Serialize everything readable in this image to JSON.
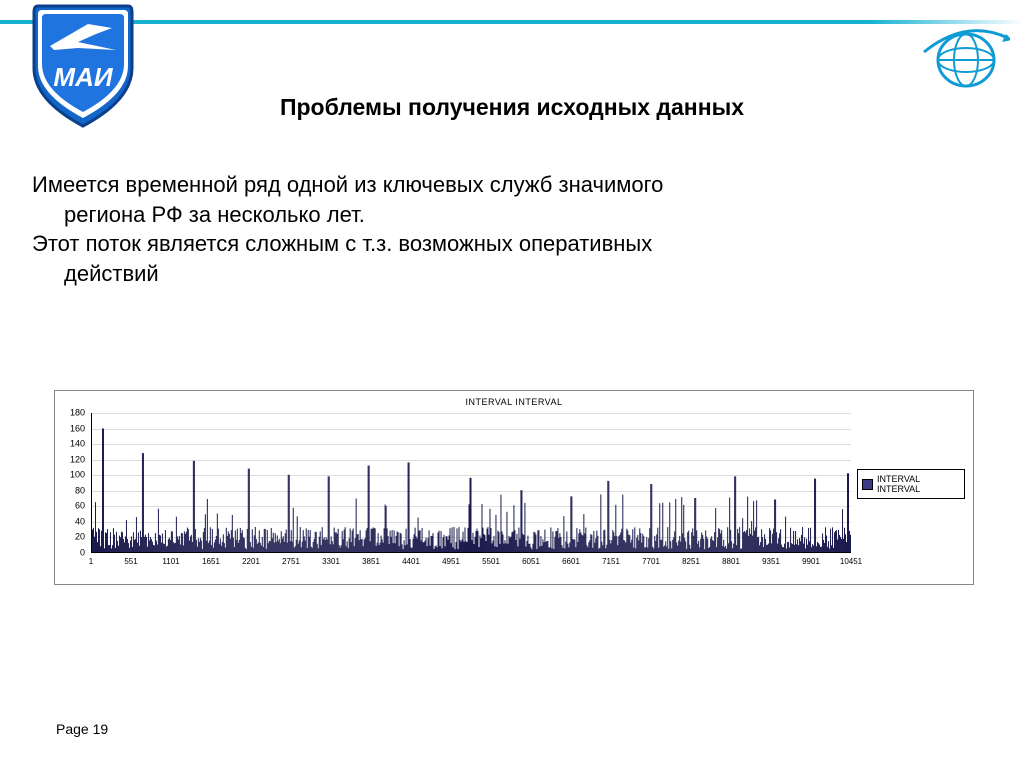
{
  "header": {
    "title": "Проблемы получения исходных данных",
    "logo_left_text": "МАИ"
  },
  "body": {
    "p1_line1": "Имеется временной ряд одной из ключевых служб значимого",
    "p1_line2": "региона РФ  за несколько лет.",
    "p2_line1": "Этот поток является сложным с т.з. возможных оперативных",
    "p2_line2": "действий"
  },
  "footer": {
    "page_label": "Page 19"
  },
  "chart_data": {
    "type": "bar",
    "title": "INTERVAL INTERVAL",
    "legend": "INTERVAL INTERVAL",
    "xlabel": "",
    "ylabel": "",
    "ylim": [
      0,
      180
    ],
    "xlim": [
      1,
      10451
    ],
    "yticks": [
      0,
      20,
      40,
      60,
      80,
      100,
      120,
      140,
      160,
      180
    ],
    "xticks": [
      1,
      551,
      1101,
      1651,
      2201,
      2751,
      3301,
      3851,
      4401,
      4951,
      5501,
      6051,
      6601,
      7151,
      7701,
      8251,
      8801,
      9351,
      9901,
      10451
    ],
    "data_description": "Dense noisy time series ~10450 samples; typical values 0–40 with many sharp spikes 60–120 and one ≈160 near the start.",
    "approx_peaks": [
      {
        "x": 150,
        "y": 160
      },
      {
        "x": 700,
        "y": 128
      },
      {
        "x": 1400,
        "y": 118
      },
      {
        "x": 2150,
        "y": 108
      },
      {
        "x": 2700,
        "y": 100
      },
      {
        "x": 3250,
        "y": 98
      },
      {
        "x": 3800,
        "y": 112
      },
      {
        "x": 4350,
        "y": 116
      },
      {
        "x": 5200,
        "y": 96
      },
      {
        "x": 5900,
        "y": 80
      },
      {
        "x": 6600,
        "y": 72
      },
      {
        "x": 7100,
        "y": 92
      },
      {
        "x": 7700,
        "y": 88
      },
      {
        "x": 8300,
        "y": 70
      },
      {
        "x": 8850,
        "y": 98
      },
      {
        "x": 9400,
        "y": 68
      },
      {
        "x": 9950,
        "y": 95
      },
      {
        "x": 10400,
        "y": 102
      }
    ],
    "baseline_estimate": 18
  }
}
